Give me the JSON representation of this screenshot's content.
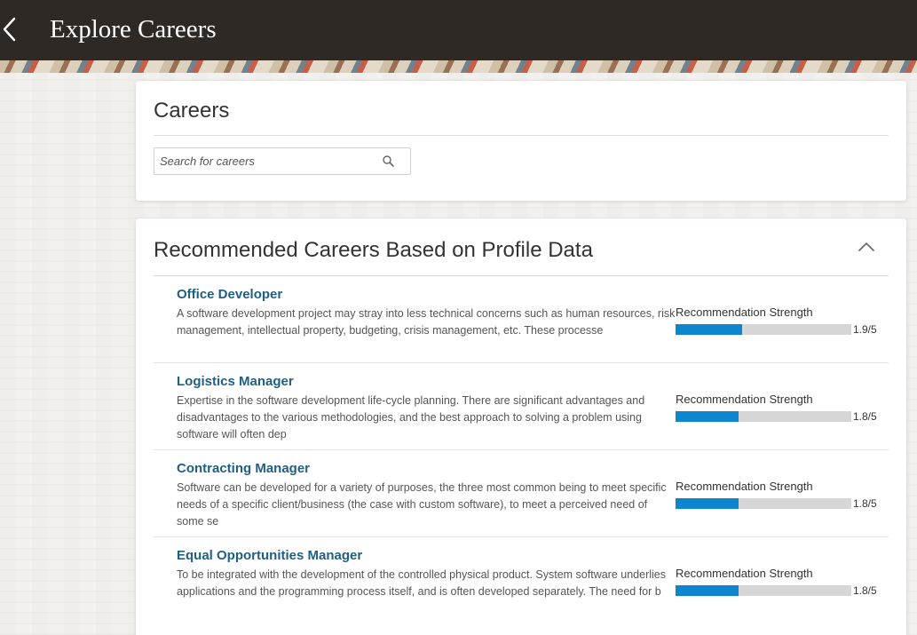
{
  "header": {
    "title": "Explore Careers",
    "back_icon": "chevron-left-icon"
  },
  "careers_card": {
    "title": "Careers",
    "search": {
      "placeholder": "Search for careers",
      "value": "",
      "icon": "search-icon"
    }
  },
  "recommendations": {
    "title": "Recommended Careers Based on Profile Data",
    "collapse_icon": "chevron-up-icon",
    "strength_max": 5,
    "colors": {
      "link": "#1f5f83",
      "bar_fill": "#0d86cf",
      "bar_track": "#d6d6d6"
    },
    "items": [
      {
        "name": "Office Developer",
        "description": "A software development project may stray into less technical concerns such as human resources, risk management, intellectual property, budgeting, crisis management, etc. These processe",
        "strength_label": "Recommendation Strength",
        "strength": 1.9,
        "strength_text": "1.9/5"
      },
      {
        "name": "Logistics Manager",
        "description": "Expertise in the software development life-cycle planning. There are significant advantages and disadvantages to the various methodologies, and the best approach to solving a problem using software will often dep",
        "strength_label": "Recommendation Strength",
        "strength": 1.8,
        "strength_text": "1.8/5"
      },
      {
        "name": "Contracting Manager",
        "description": "Software can be developed for a variety of purposes, the three most common being to meet specific needs of a specific client/business (the case with custom software), to meet a perceived need of some se",
        "strength_label": "Recommendation Strength",
        "strength": 1.8,
        "strength_text": "1.8/5"
      },
      {
        "name": "Equal Opportunities Manager",
        "description": "To be integrated with the development of the controlled physical product. System software underlies applications and the programming process itself, and is often developed separately. The need for b",
        "strength_label": "Recommendation Strength",
        "strength": 1.8,
        "strength_text": "1.8/5"
      }
    ]
  }
}
